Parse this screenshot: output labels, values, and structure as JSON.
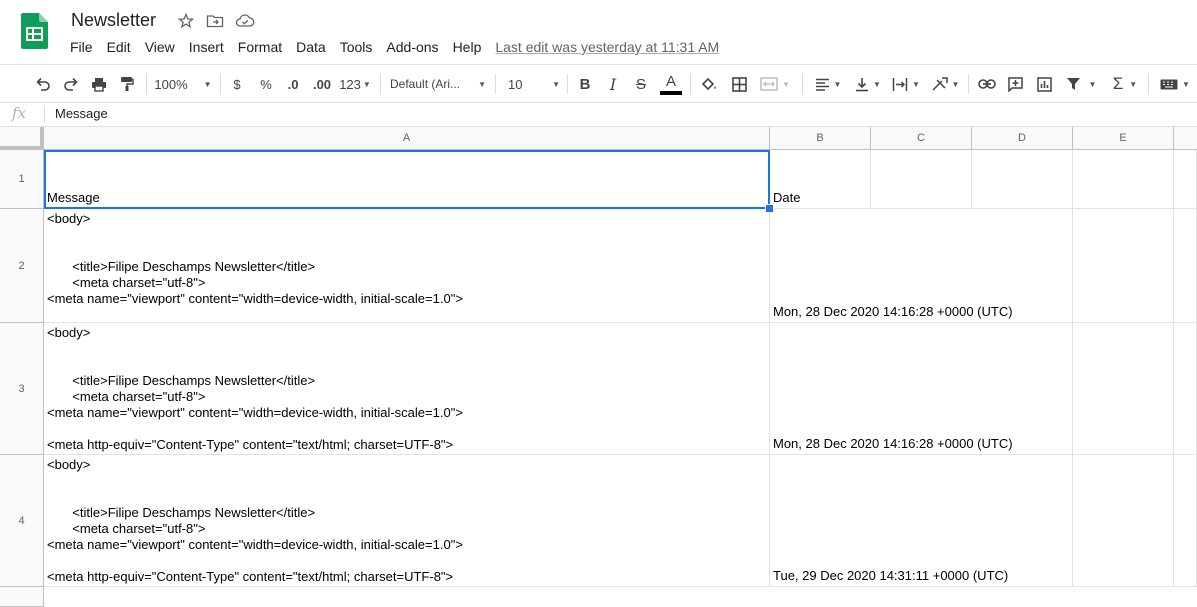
{
  "header": {
    "title": "Newsletter",
    "last_edit": "Last edit was yesterday at 11:31 AM",
    "menu": [
      "File",
      "Edit",
      "View",
      "Insert",
      "Format",
      "Data",
      "Tools",
      "Add-ons",
      "Help"
    ]
  },
  "toolbar": {
    "zoom": "100%",
    "currency": "$",
    "percent": "%",
    "decrease_decimal": ".0",
    "increase_decimal": ".00",
    "more_formats": "123",
    "font": "Default (Ari...",
    "font_size": "10",
    "bold": "B",
    "italic": "I",
    "strike": "S",
    "text_color": "A"
  },
  "formula_bar": {
    "fx": "fx",
    "value": "Message"
  },
  "grid": {
    "columns": [
      "A",
      "B",
      "C",
      "D",
      "E"
    ],
    "rows": [
      {
        "num": "1",
        "a": "Message",
        "b": "Date"
      },
      {
        "num": "2",
        "a": "<body>\n\n\n       <title>Filipe Deschamps Newsletter</title>\n       <meta charset=\"utf-8\">\n<meta name=\"viewport\" content=\"width=device-width, initial-scale=1.0\">",
        "b": "Mon, 28 Dec 2020 14:16:28 +0000 (UTC)"
      },
      {
        "num": "3",
        "a": "<body>\n\n\n       <title>Filipe Deschamps Newsletter</title>\n       <meta charset=\"utf-8\">\n<meta name=\"viewport\" content=\"width=device-width, initial-scale=1.0\">\n\n<meta http-equiv=\"Content-Type\" content=\"text/html; charset=UTF-8\">",
        "b": "Mon, 28 Dec 2020 14:16:28 +0000 (UTC)"
      },
      {
        "num": "4",
        "a": "<body>\n\n\n       <title>Filipe Deschamps Newsletter</title>\n       <meta charset=\"utf-8\">\n<meta name=\"viewport\" content=\"width=device-width, initial-scale=1.0\">\n\n<meta http-equiv=\"Content-Type\" content=\"text/html; charset=UTF-8\">",
        "b": "Tue, 29 Dec 2020 14:31:11 +0000 (UTC)"
      }
    ]
  },
  "colors": {
    "logo_green": "#0f9d58",
    "selection_blue": "#1a73e8"
  },
  "icons": [
    "sheets-logo-icon",
    "star-icon",
    "move-folder-icon",
    "cloud-saved-icon"
  ]
}
